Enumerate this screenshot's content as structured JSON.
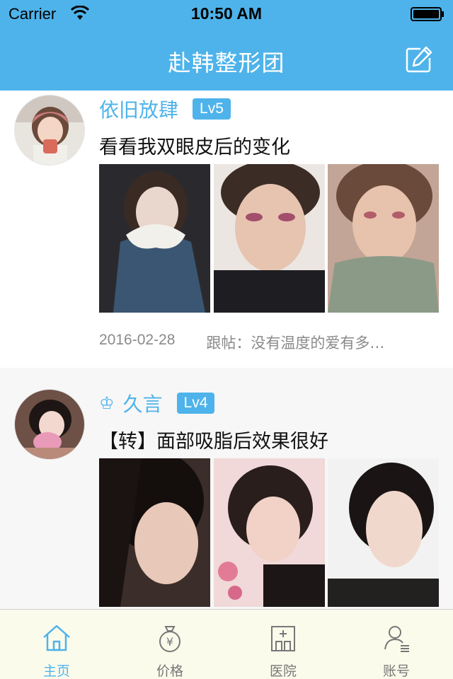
{
  "status_bar": {
    "carrier": "Carrier",
    "time": "10:50 AM"
  },
  "nav": {
    "title": "赴韩整形团"
  },
  "posts": [
    {
      "username": "依旧放肆",
      "level": "Lv5",
      "title": "看看我双眼皮后的变化",
      "date": "2016-02-28",
      "reply": "跟帖：没有温度的爱有多…"
    },
    {
      "username": "久言",
      "level": "Lv4",
      "title": "【转】面部吸脂后效果很好"
    }
  ],
  "tabs": [
    {
      "label": "主页",
      "icon": "home-icon",
      "active": true
    },
    {
      "label": "价格",
      "icon": "money-bag-icon",
      "active": false
    },
    {
      "label": "医院",
      "icon": "hospital-icon",
      "active": false
    },
    {
      "label": "账号",
      "icon": "account-icon",
      "active": false
    }
  ],
  "colors": {
    "accent": "#4eb3ea",
    "tab_bar_bg": "#fbfbec",
    "meta_text": "#8a8a8a"
  }
}
